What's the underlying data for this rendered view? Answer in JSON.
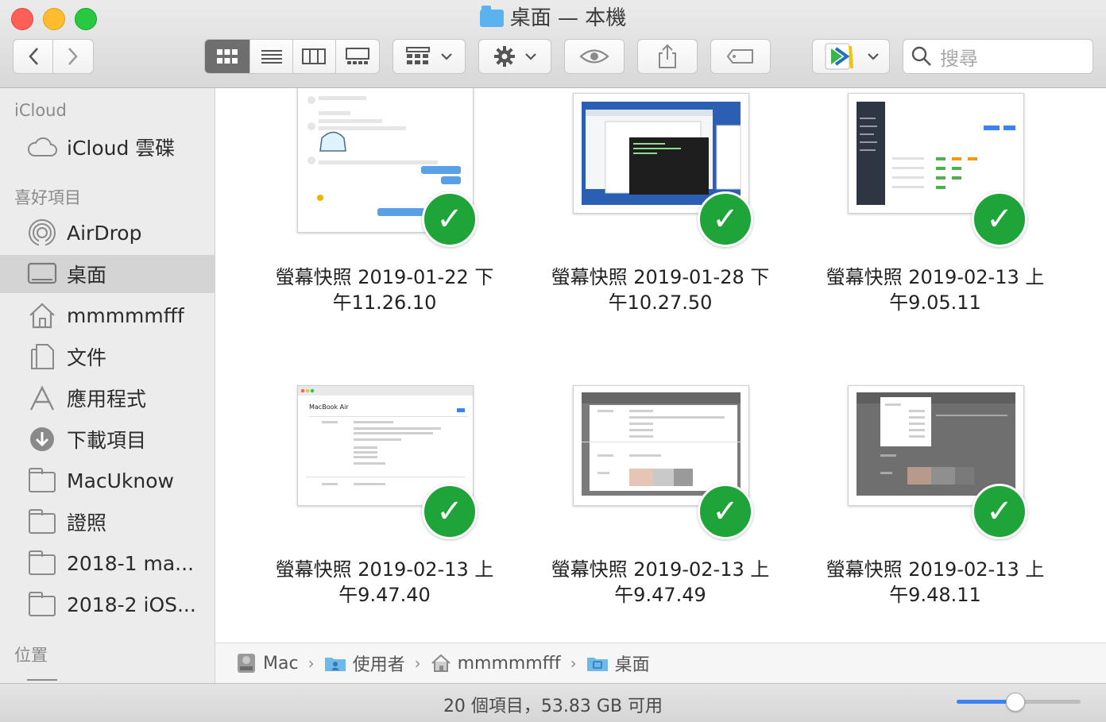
{
  "window": {
    "title": "桌面 — 本機"
  },
  "toolbar": {
    "back_icon": "chevron-left-icon",
    "forward_icon": "chevron-right-icon",
    "view_modes": [
      "icon-view",
      "list-view",
      "column-view",
      "gallery-view"
    ],
    "active_view": "icon-view",
    "search_placeholder": "搜尋"
  },
  "sidebar": {
    "sections": [
      {
        "title": "iCloud",
        "items": [
          {
            "label": "iCloud 雲碟",
            "icon": "cloud-icon"
          }
        ]
      },
      {
        "title": "喜好項目",
        "items": [
          {
            "label": "AirDrop",
            "icon": "airdrop-icon"
          },
          {
            "label": "桌面",
            "icon": "desktop-icon",
            "selected": true
          },
          {
            "label": "mmmmmfff",
            "icon": "home-icon"
          },
          {
            "label": "文件",
            "icon": "document-icon"
          },
          {
            "label": "應用程式",
            "icon": "applications-icon"
          },
          {
            "label": "下載項目",
            "icon": "download-icon"
          },
          {
            "label": "MacUknow",
            "icon": "folder-icon"
          },
          {
            "label": "證照",
            "icon": "folder-icon"
          },
          {
            "label": "2018-1 ma...",
            "icon": "folder-icon"
          },
          {
            "label": "2018-2 iOS...",
            "icon": "folder-icon"
          }
        ]
      },
      {
        "title": "位置",
        "items": []
      }
    ]
  },
  "files": [
    {
      "line1": "螢幕快照 2019-01-22 下",
      "line2": "午11.26.10",
      "thumb": "chat"
    },
    {
      "line1": "螢幕快照 2019-01-28 下",
      "line2": "午10.27.50",
      "thumb": "desktop"
    },
    {
      "line1": "螢幕快照 2019-02-13 上",
      "line2": "午9.05.11",
      "thumb": "admin"
    },
    {
      "line1": "螢幕快照 2019-02-13 上",
      "line2": "午9.47.40",
      "thumb": "doc",
      "thumb_title": "MacBook Air"
    },
    {
      "line1": "螢幕快照 2019-02-13 上",
      "line2": "午9.47.49",
      "thumb": "doc-gray"
    },
    {
      "line1": "螢幕快照 2019-02-13 上",
      "line2": "午9.48.11",
      "thumb": "doc-dark"
    }
  ],
  "pathbar": [
    {
      "label": "Mac",
      "icon": "hard-drive-icon"
    },
    {
      "label": "使用者",
      "icon": "users-folder-icon"
    },
    {
      "label": "mmmmmfff",
      "icon": "home-icon"
    },
    {
      "label": "桌面",
      "icon": "desktop-folder-icon"
    }
  ],
  "status": {
    "text": "20 個項目，53.83 GB 可用",
    "zoom_level": 0.47
  },
  "colors": {
    "check": "#1fa43a",
    "selection": "#d4d4d4",
    "accent": "#3b82f6"
  }
}
